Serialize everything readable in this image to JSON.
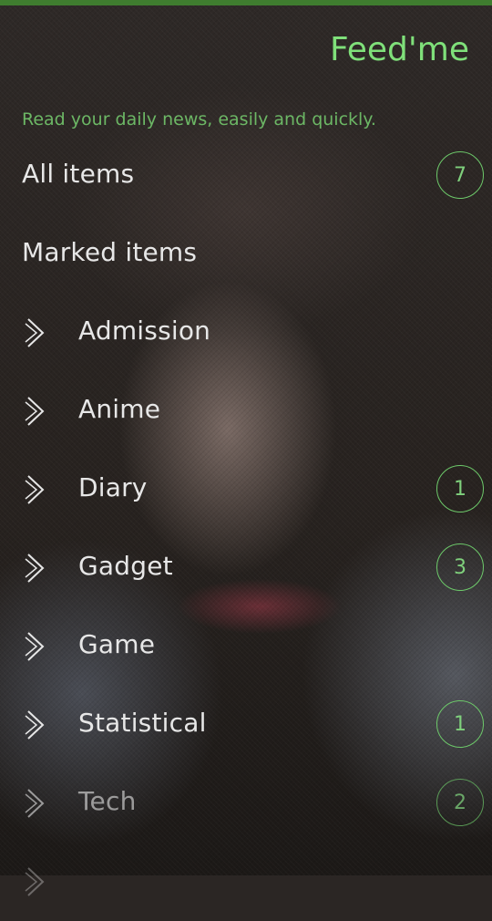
{
  "app": {
    "title": "Feed'me",
    "tagline": "Read your daily news, easily and quickly.",
    "accent_color": "#7fe07a"
  },
  "summary": {
    "all_items": {
      "label": "All items",
      "count": "7"
    },
    "marked_items": {
      "label": "Marked items"
    }
  },
  "categories": [
    {
      "label": "Admission",
      "count": ""
    },
    {
      "label": "Anime",
      "count": ""
    },
    {
      "label": "Diary",
      "count": "1"
    },
    {
      "label": "Gadget",
      "count": "3"
    },
    {
      "label": "Game",
      "count": ""
    },
    {
      "label": "Statistical",
      "count": "1"
    },
    {
      "label": "Tech",
      "count": "2"
    }
  ],
  "icons": {
    "category_expand": "chevron-right-icon"
  }
}
